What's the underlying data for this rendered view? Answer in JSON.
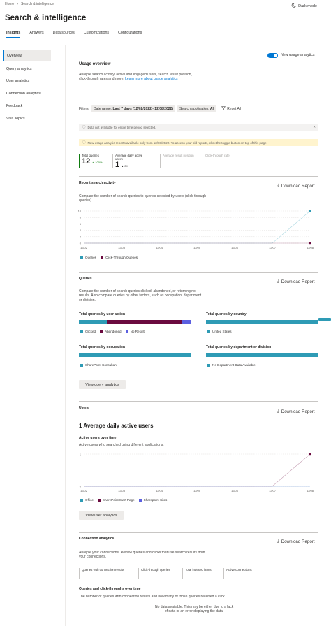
{
  "breadcrumb": [
    "Home",
    "Search & intelligence"
  ],
  "dark_mode_label": "Dark mode",
  "page_title": "Search & intelligence",
  "tabs": [
    "Insights",
    "Answers",
    "Data sources",
    "Customizations",
    "Configurations"
  ],
  "nav": [
    "Overview",
    "Query analytics",
    "User analytics",
    "Connection analytics",
    "Feedback",
    "Viva Topics"
  ],
  "toggle_label": "New usage analytics",
  "usage": {
    "title": "Usage overview",
    "desc": "Analyze search activity, active and engaged users, search result position, click-through rates and more.",
    "link": "Learn more about usage analytics"
  },
  "filters": {
    "label": "Filters:",
    "date_key": "Date range:",
    "date_val": "Last 7 days (12/02/2022 - 12/08/2022)",
    "app_key": "Search application:",
    "app_val": "All",
    "reset": "Reset All"
  },
  "msg_info": "Data not available for entire time period selected.",
  "msg_warn": "New usage analytic reports available only from 12/08/2022. To access your old reports, click the toggle button on top of this page.",
  "kpis": [
    {
      "label": "Total queries",
      "value": "12",
      "delta": "▲ 100%"
    },
    {
      "label": "Average daily active users",
      "value": "1",
      "delta": "▲ 0%"
    },
    {
      "label": "Average result position",
      "value": "--"
    },
    {
      "label": "Click-through rate",
      "value": "--"
    }
  ],
  "download_label": "Download Report",
  "recent": {
    "title": "Recent search activity",
    "desc": "Compare the number of search queries to queries selected by users (click-through queries).",
    "legend": [
      "Queries",
      "Click-Through Queries"
    ]
  },
  "queries": {
    "title": "Queries",
    "desc": "Compare the number of search queries clicked, abandoned, or returning no results. Also compare queries by other factors, such as occupation, department or division.",
    "by_action": "Total queries by user action",
    "action_legend": [
      "Clicked",
      "Abandoned",
      "No Result"
    ],
    "by_country": "Total queries by country",
    "country_legend": [
      "United States"
    ],
    "by_occupation": "Total queries by occupation",
    "occupation_legend": [
      "SharePoint Consultant"
    ],
    "by_department": "Total queries by department or division",
    "department_legend": [
      "No Department Data Available"
    ],
    "button": "View query analytics"
  },
  "users": {
    "title": "Users",
    "headline": "1  Average daily active users",
    "sub": "Active users over time",
    "desc": "Active users who searched using different applications.",
    "legend": [
      "Office",
      "SharePoint Start Page",
      "Sharepoint Sites"
    ],
    "button": "View user analytics"
  },
  "connection": {
    "title": "Connection analytics",
    "desc": "Analyze your connections. Review queries and clicks that use search results from your connections.",
    "kpis": [
      {
        "label": "Queries with connection results",
        "value": "--"
      },
      {
        "label": "Click-through queries",
        "value": "--"
      },
      {
        "label": "Total indexed items",
        "value": "--"
      },
      {
        "label": "Active connections",
        "value": "--"
      }
    ],
    "sub": "Queries and click-throughs over time",
    "sub_desc": "The number of queries with connection results and how many of those queries received a click.",
    "nodata1": "No data available. This may be either due to a lack",
    "nodata2": "of data or an error displaying the data."
  },
  "colors": {
    "accent": "#0078d4",
    "teal": "#2e9bb5",
    "maroon": "#6b0a3f",
    "violet": "#5b5fe0",
    "info_bg": "#f3f2f1",
    "warn_bg": "#fff4ce",
    "kpi_green": "#107c10"
  },
  "chart_data": [
    {
      "type": "line",
      "x": [
        "12/02",
        "12/03",
        "12/04",
        "12/05",
        "12/06",
        "12/07",
        "12/08"
      ],
      "ylim": [
        0,
        10
      ],
      "yticks": [
        0,
        2,
        4,
        6,
        8,
        10
      ],
      "series": [
        {
          "name": "Queries",
          "values": [
            0,
            0,
            0,
            0,
            0,
            0,
            10
          ]
        },
        {
          "name": "Click-Through Queries",
          "values": [
            0,
            0,
            0,
            0,
            0,
            0,
            0
          ]
        }
      ]
    },
    {
      "type": "bar",
      "categories": [
        "Clicked",
        "Abandoned",
        "No Result"
      ],
      "values": [
        3,
        8,
        1
      ]
    },
    {
      "type": "line",
      "x": [
        "12/02",
        "12/03",
        "12/04",
        "12/05",
        "12/06",
        "12/07",
        "12/08"
      ],
      "ylim": [
        0,
        1
      ],
      "yticks": [
        0,
        1
      ],
      "series": [
        {
          "name": "Office",
          "values": [
            0,
            0,
            0,
            0,
            0,
            0,
            0
          ]
        },
        {
          "name": "SharePoint Start Page",
          "values": [
            0,
            0,
            0,
            0,
            0,
            0,
            1
          ]
        },
        {
          "name": "Sharepoint Sites",
          "values": [
            0,
            0,
            0,
            0,
            0,
            0,
            0
          ]
        }
      ]
    }
  ]
}
